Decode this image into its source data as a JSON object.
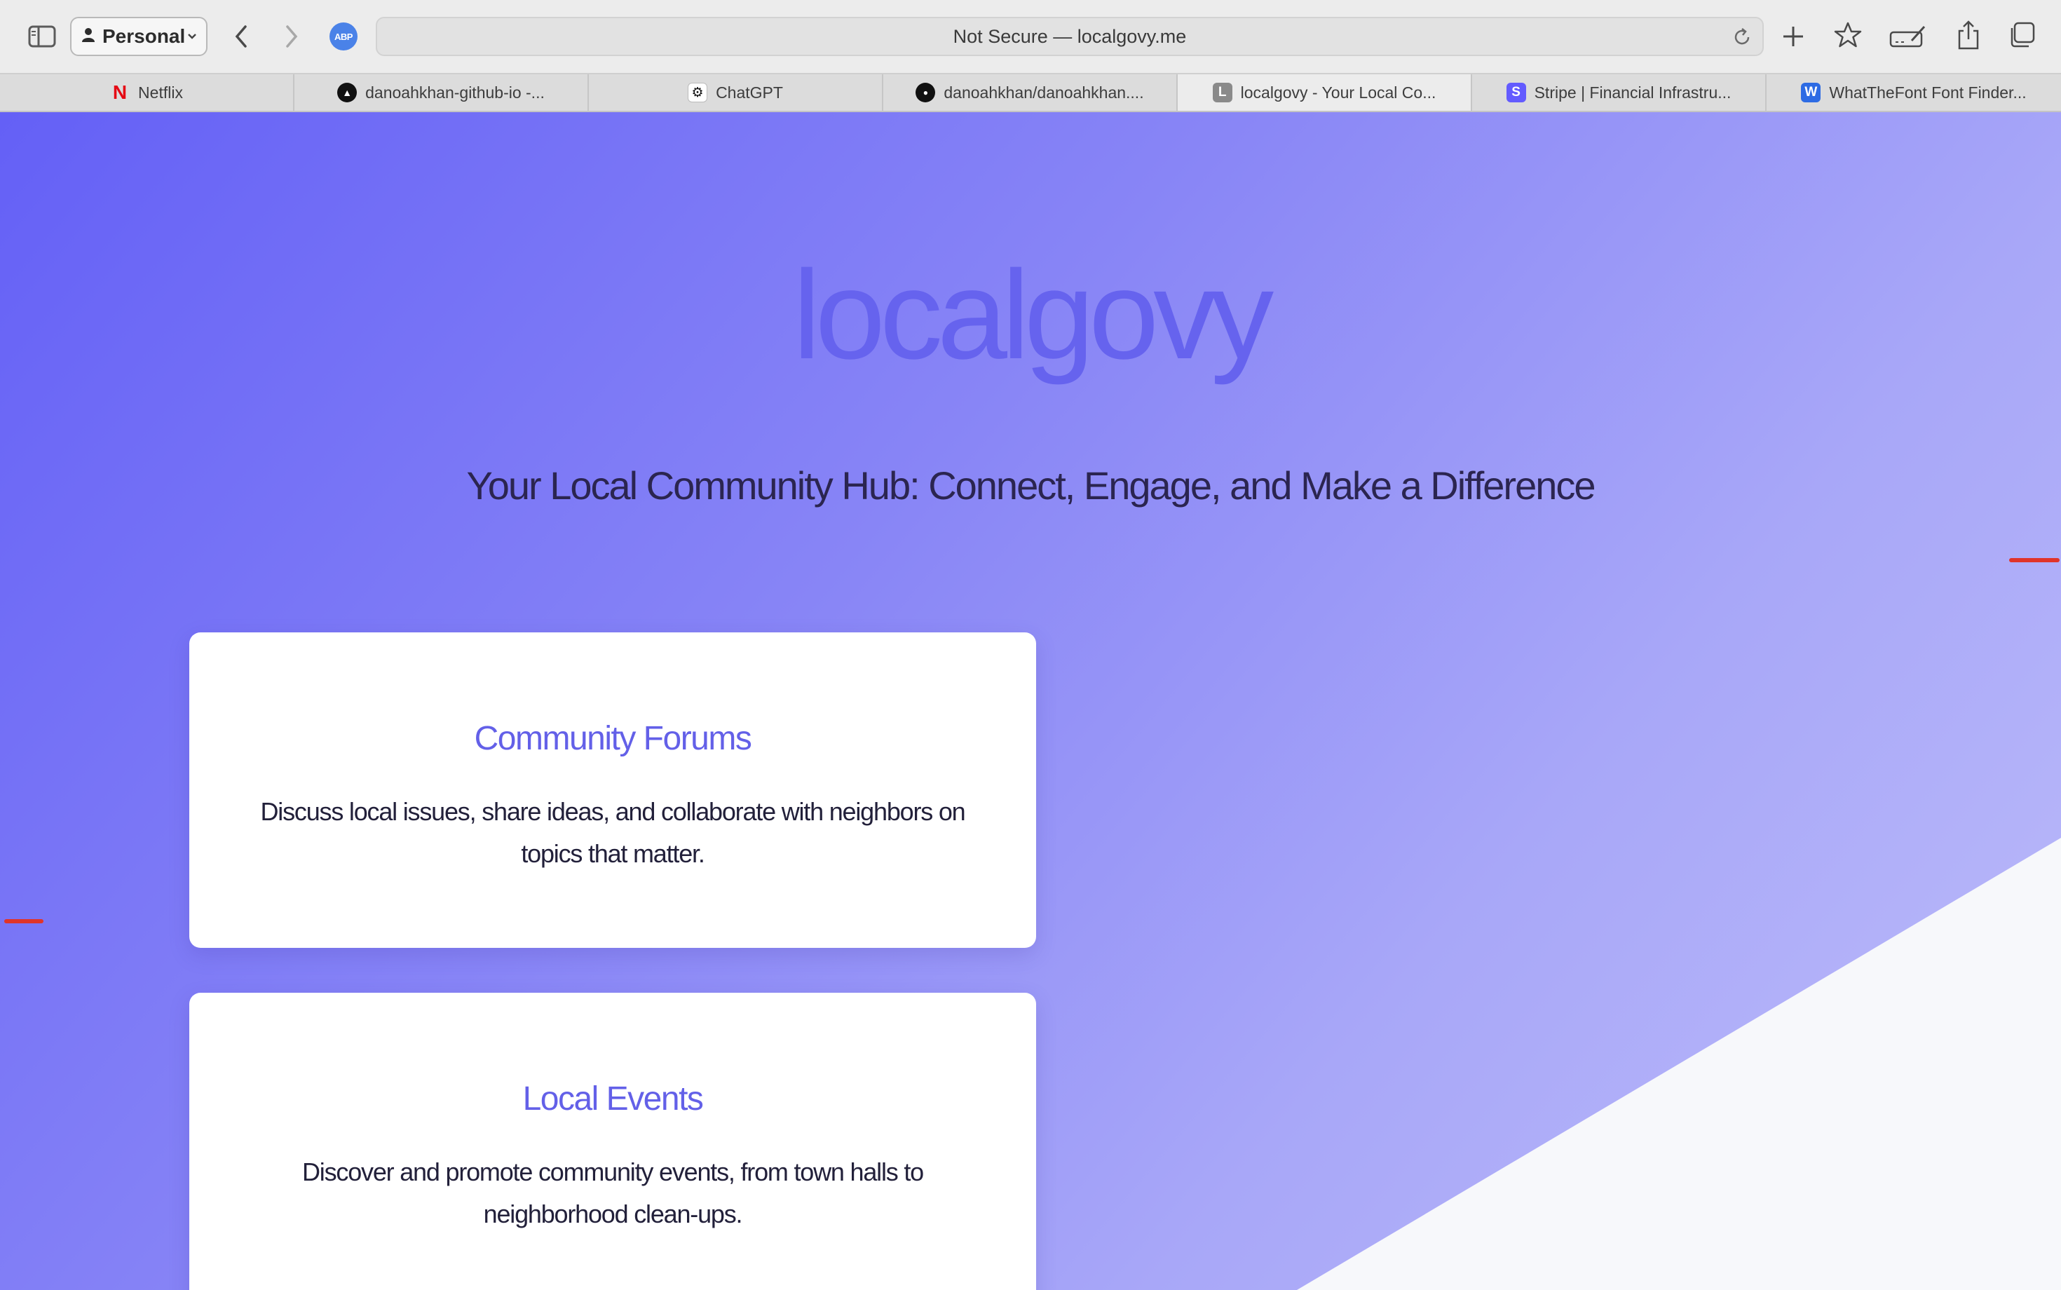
{
  "browser": {
    "profile_label": "Personal",
    "adblock_label": "ABP",
    "url_text": "Not Secure — localgovy.me",
    "tabs": [
      {
        "label": "Netflix",
        "favicon": "N",
        "favicon_color": "#e50914"
      },
      {
        "label": "danoahkhan-github-io -...",
        "favicon": "▲",
        "favicon_color": "#111111"
      },
      {
        "label": "ChatGPT",
        "favicon": "⚙",
        "favicon_color": "#ffffff"
      },
      {
        "label": "danoahkhan/danoahkhan....",
        "favicon": "●",
        "favicon_color": "#111111"
      },
      {
        "label": "localgovy - Your Local Co...",
        "favicon": "L",
        "favicon_color": "#8a8a8a"
      },
      {
        "label": "Stripe | Financial Infrastru...",
        "favicon": "S",
        "favicon_color": "#635bff"
      },
      {
        "label": "WhatTheFont Font Finder...",
        "favicon": "W",
        "favicon_color": "#2d6be4"
      }
    ]
  },
  "page": {
    "logo": "localgovy",
    "tagline": "Your Local Community Hub: Connect, Engage, and Make a Difference",
    "cards": [
      {
        "title": "Community Forums",
        "description": "Discuss local issues, share ideas, and collaborate with neighbors on topics that matter."
      },
      {
        "title": "Local Events",
        "description": "Discover and promote community events, from town halls to neighborhood clean-ups."
      }
    ]
  },
  "colors": {
    "accent": "#6360e8",
    "hero_gradient_start": "#6460f6",
    "hero_gradient_end": "#bdbcfa"
  }
}
